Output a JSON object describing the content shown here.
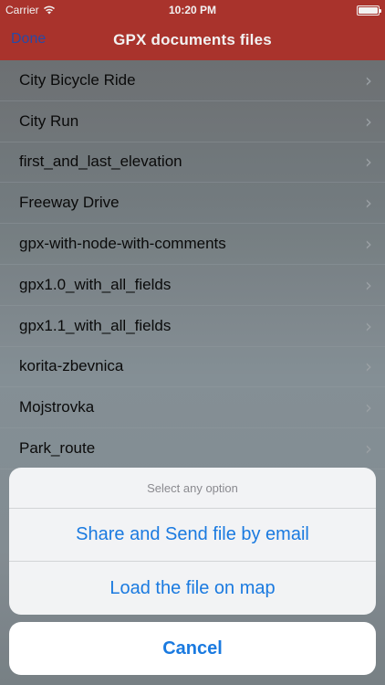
{
  "status_bar": {
    "carrier": "Carrier",
    "time": "10:20 PM",
    "battery_level": 1.0
  },
  "nav": {
    "left_button": "Done",
    "title": "GPX documents files"
  },
  "files": [
    "City Bicycle Ride",
    "City Run",
    "first_and_last_elevation",
    "Freeway Drive",
    "gpx-with-node-with-comments",
    "gpx1.0_with_all_fields",
    "gpx1.1_with_all_fields",
    "korita-zbevnica",
    "Mojstrovka",
    "Park_route"
  ],
  "action_sheet": {
    "title": "Select any option",
    "options": [
      "Share and Send file by email",
      "Load the file on map"
    ],
    "cancel": "Cancel"
  },
  "colors": {
    "nav_bar": "#b3362f",
    "action_tint": "#1a7ae0"
  },
  "icons": {
    "wifi": "wifi-icon",
    "battery": "battery-icon",
    "disclosure": "chevron-right-icon"
  }
}
